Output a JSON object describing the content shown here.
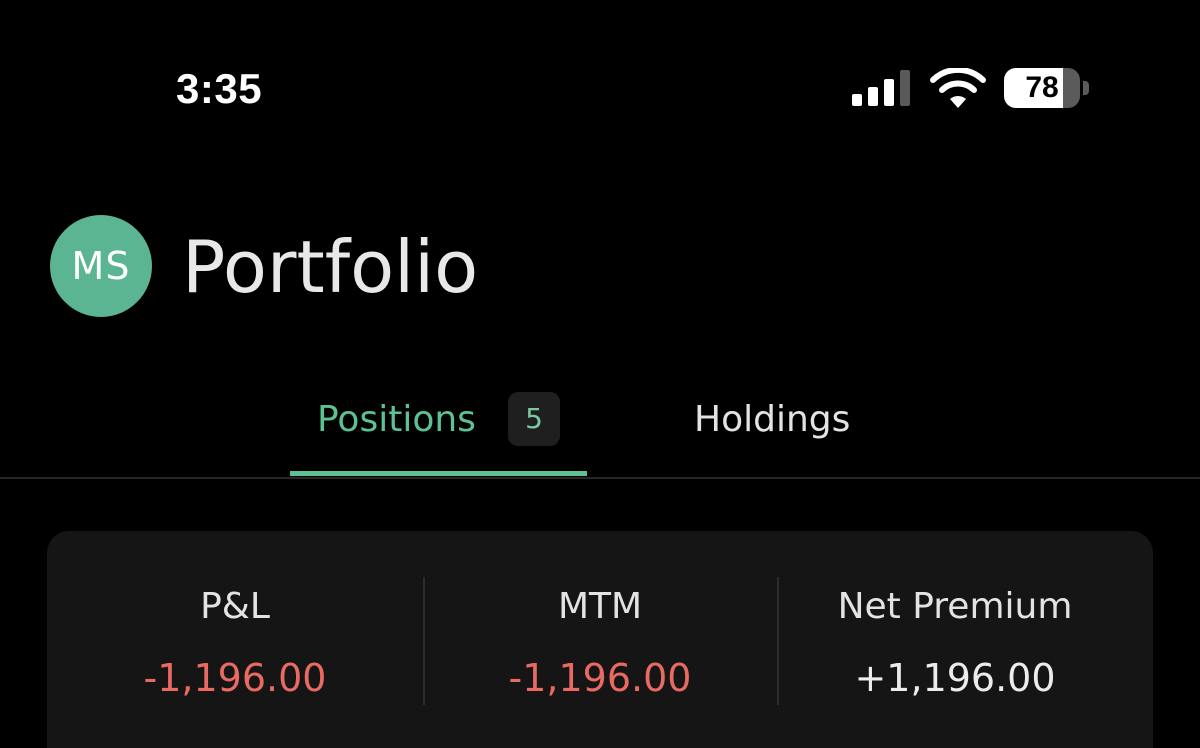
{
  "status_bar": {
    "time": "3:35",
    "battery_level": "78",
    "battery_fraction": 0.78,
    "signal_icon": "cellular-signal-icon",
    "wifi_icon": "wifi-icon"
  },
  "header": {
    "avatar_initials": "MS",
    "title": "Portfolio"
  },
  "tabs": [
    {
      "label": "Positions",
      "badge": "5",
      "active": true
    },
    {
      "label": "Holdings",
      "active": false
    }
  ],
  "summary": [
    {
      "label": "P&L",
      "value": "-1,196.00",
      "tone": "negative"
    },
    {
      "label": "MTM",
      "value": "-1,196.00",
      "tone": "negative"
    },
    {
      "label": "Net Premium",
      "value": "+1,196.00",
      "tone": "neutral"
    }
  ],
  "colors": {
    "accent": "#5cc193",
    "negative": "#e86a62",
    "neutral": "#ececec",
    "avatar": "#5bb592",
    "card": "#151515",
    "background": "#000000"
  }
}
